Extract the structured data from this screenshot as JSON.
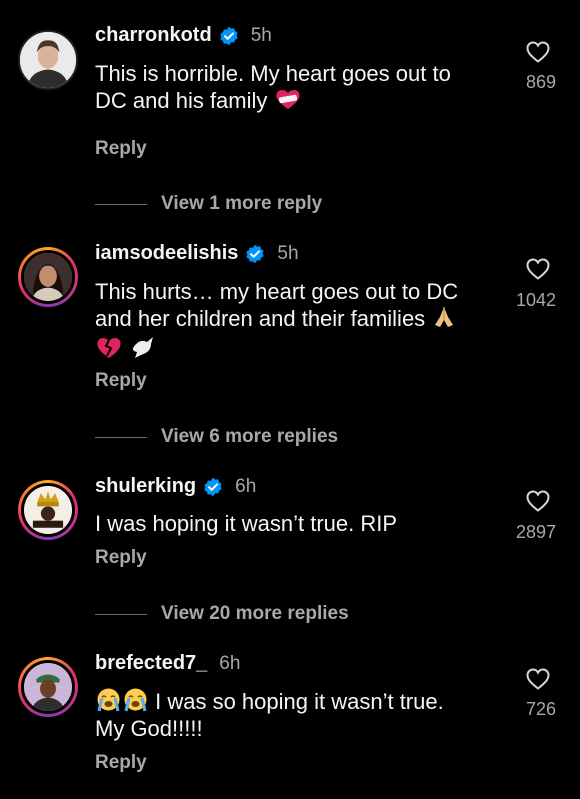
{
  "comments": [
    {
      "username": "charronkotd",
      "verified": true,
      "time": "5h",
      "line1": "This is horrible.  My heart goes out to",
      "line2": "DC and his family",
      "likes": "869",
      "reply": "Reply",
      "view_more": "View 1 more reply"
    },
    {
      "username": "iamsodeelishis",
      "verified": true,
      "time": "5h",
      "line1": "This hurts… my heart goes out to DC",
      "line2": "and her children and their families",
      "likes": "1042",
      "reply": "Reply",
      "view_more": "View 6 more replies"
    },
    {
      "username": "shulerking",
      "verified": true,
      "time": "6h",
      "line1": "I was hoping it wasn’t true. RIP",
      "likes": "2897",
      "reply": "Reply",
      "view_more": "View 20 more replies"
    },
    {
      "username": "brefected7_",
      "verified": false,
      "time": "6h",
      "line1": "I was so hoping it wasn’t true.",
      "line2": "My God!!!!!",
      "likes": "726",
      "reply": "Reply"
    }
  ],
  "icons": {
    "heart_outline": "heart-icon",
    "verified": "verified-badge-icon",
    "emoji_heart_bandage": "mending-heart-emoji",
    "emoji_pray": "folded-hands-emoji",
    "emoji_broken_heart": "broken-heart-emoji",
    "emoji_dove": "dove-emoji",
    "emoji_sob": "loudly-crying-face-emoji"
  },
  "colors": {
    "background": "#000000",
    "primary_text": "#f5f5f5",
    "secondary_text": "#a8a8a8",
    "verified_blue": "#0095f6"
  }
}
